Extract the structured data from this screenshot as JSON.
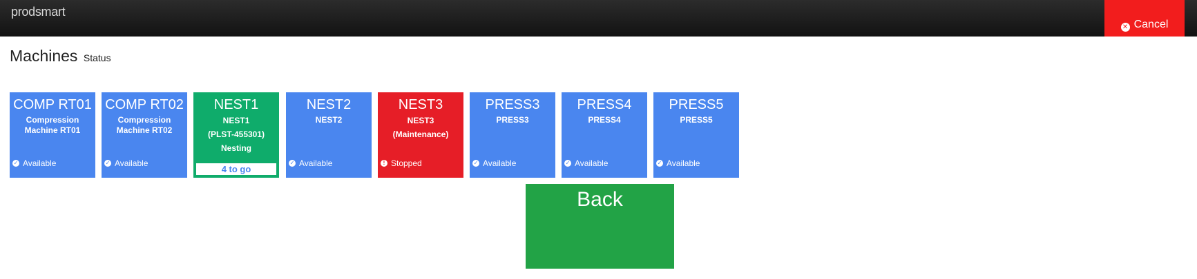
{
  "header": {
    "brand": "prodsmart",
    "cancel_label": "Cancel",
    "cancel_icon": "times-circle-icon"
  },
  "page": {
    "title": "Machines",
    "subtitle": "Status"
  },
  "colors": {
    "available": "#4a86ef",
    "in_progress": "#0fac6b",
    "stopped": "#e61e27",
    "back": "#22a346",
    "cancel": "#f21d1d"
  },
  "machines": [
    {
      "name": "COMP RT01",
      "desc": "Compression Machine RT01",
      "status": "Available",
      "state": "available"
    },
    {
      "name": "COMP RT02",
      "desc": "Compression Machine RT02",
      "status": "Available",
      "state": "available"
    },
    {
      "name": "NEST1",
      "desc1": "NEST1",
      "desc2": "(PLST-455301)",
      "desc3": "Nesting",
      "progress": "4 to go",
      "state": "in_progress"
    },
    {
      "name": "NEST2",
      "desc": "NEST2",
      "status": "Available",
      "state": "available"
    },
    {
      "name": "NEST3",
      "desc1": "NEST3",
      "desc2": "(Maintenance)",
      "status": "Stopped",
      "state": "stopped"
    },
    {
      "name": "PRESS3",
      "desc": "PRESS3",
      "status": "Available",
      "state": "available"
    },
    {
      "name": "PRESS4",
      "desc": "PRESS4",
      "status": "Available",
      "state": "available"
    },
    {
      "name": "PRESS5",
      "desc": "PRESS5",
      "status": "Available",
      "state": "available"
    }
  ],
  "back_label": "Back"
}
